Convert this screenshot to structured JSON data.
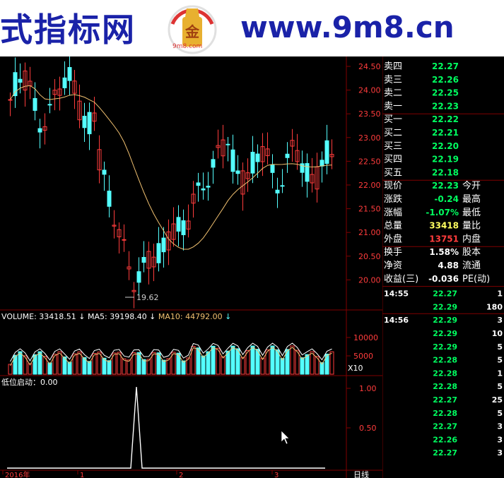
{
  "banner": {
    "left_text": "式指标网",
    "logo_text": "9m8.com",
    "right_text": "www.9m8.cn"
  },
  "colors": {
    "up": "#ff3c3c",
    "down": "#54ffff",
    "ma": "#f0c070",
    "grid": "#800000",
    "green": "#00ff60",
    "white": "#ffffff"
  },
  "chart_data": {
    "type": "candlestick",
    "price_axis": [
      "24.50",
      "24.00",
      "23.50",
      "23.00",
      "22.50",
      "22.00",
      "21.50",
      "21.00",
      "20.50",
      "20.00"
    ],
    "low_label": "19.62",
    "volume_header": {
      "volume": "VOLUME: 33418.51",
      "ma5": "MA5: 39198.40",
      "ma10": "MA10: 44792.00"
    },
    "volume_axis": [
      "10000",
      "5000"
    ],
    "volume_unit": "X10",
    "indicator_header": "低位启动：0.00",
    "indicator_axis": [
      "1.00",
      "0.50"
    ],
    "date_labels": [
      "2016年",
      "1",
      "2",
      "3"
    ],
    "date_right": "日线"
  },
  "quotes": {
    "sell": [
      {
        "label": "卖四",
        "price": "22.27"
      },
      {
        "label": "卖三",
        "price": "22.26"
      },
      {
        "label": "卖二",
        "price": "22.25"
      },
      {
        "label": "卖一",
        "price": "22.23"
      }
    ],
    "buy": [
      {
        "label": "买一",
        "price": "22.22"
      },
      {
        "label": "买二",
        "price": "22.21"
      },
      {
        "label": "买三",
        "price": "22.20"
      },
      {
        "label": "买四",
        "price": "22.19"
      },
      {
        "label": "买五",
        "price": "22.18"
      }
    ],
    "stats": [
      {
        "label": "现价",
        "value": "22.23",
        "label2": "今开"
      },
      {
        "label": "涨跌",
        "value": "-0.24",
        "label2": "最高"
      },
      {
        "label": "涨幅",
        "value": "-1.07%",
        "label2": "最低"
      },
      {
        "label": "总量",
        "value": "33418",
        "label2": "量比"
      },
      {
        "label": "外盘",
        "value": "13751",
        "label2": "内盘"
      }
    ],
    "stats2": [
      {
        "label": "换手",
        "value": "1.58%",
        "label2": "股本"
      },
      {
        "label": "净资",
        "value": "4.88",
        "label2": "流通"
      },
      {
        "label": "收益(三)",
        "value": "-0.036",
        "label2": "PE(动)"
      }
    ],
    "ticks": [
      {
        "time": "14:55",
        "price": "22.27",
        "vol": "1"
      },
      {
        "time": "",
        "price": "22.29",
        "vol": "180"
      },
      {
        "time": "14:56",
        "price": "22.29",
        "vol": "3"
      },
      {
        "time": "",
        "price": "22.29",
        "vol": "10"
      },
      {
        "time": "",
        "price": "22.29",
        "vol": "5"
      },
      {
        "time": "",
        "price": "22.28",
        "vol": "5"
      },
      {
        "time": "",
        "price": "22.28",
        "vol": "1"
      },
      {
        "time": "",
        "price": "22.28",
        "vol": "5"
      },
      {
        "time": "",
        "price": "22.27",
        "vol": "25"
      },
      {
        "time": "",
        "price": "22.28",
        "vol": "5"
      },
      {
        "time": "",
        "price": "22.27",
        "vol": "3"
      },
      {
        "time": "",
        "price": "22.26",
        "vol": "3"
      },
      {
        "time": "",
        "price": "22.27",
        "vol": "3"
      }
    ]
  }
}
